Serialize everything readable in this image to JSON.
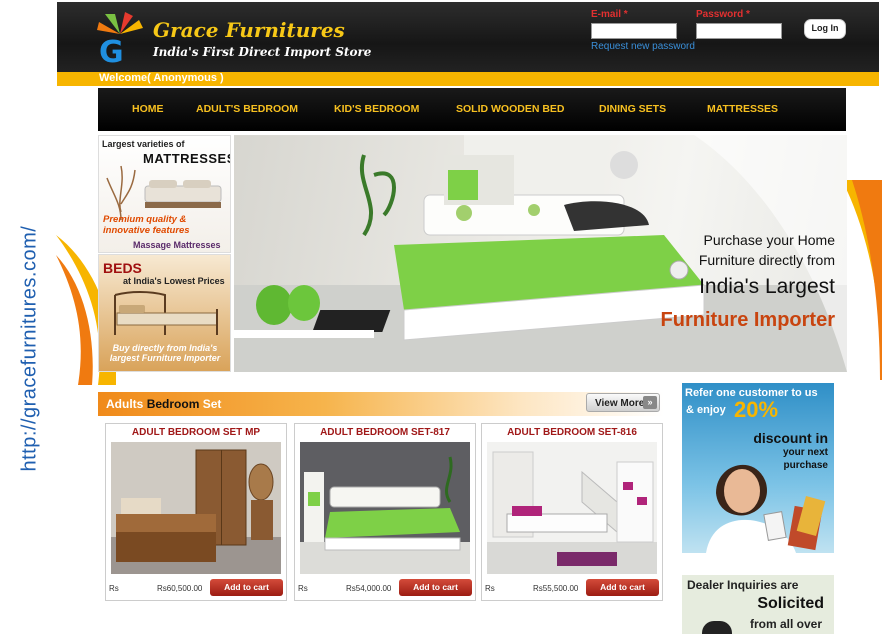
{
  "side_url": "http://gracefurnitures.com/",
  "header": {
    "brand": "Grace Furnitures",
    "tagline": "India's First Direct Import Store",
    "email_label": "E-mail *",
    "password_label": "Password *",
    "email_value": "",
    "password_value": "",
    "login_label": "Log In",
    "forgot_link": "Request new password",
    "welcome": "Welcome( Anonymous )"
  },
  "nav": {
    "items": [
      "HOME",
      "ADULT'S BEDROOM",
      "KID'S BEDROOM",
      "SOLID WOODEN BED",
      "DINING SETS",
      "MATTRESSES"
    ]
  },
  "promo_mattress": {
    "line1": "Largest varieties of",
    "heading": "MATTRESSES",
    "features": "Premium quality & innovative features",
    "caption": "Massage Mattresses"
  },
  "promo_beds": {
    "heading": "BEDS",
    "sub": "at India's Lowest Prices",
    "caption": "Buy directly from India's largest Furniture Importer"
  },
  "banner": {
    "line1": "Purchase your Home",
    "line2": "Furniture directly from",
    "line3": "India's Largest",
    "line4": "Furniture Importer"
  },
  "section": {
    "title_part1": "Adults",
    "title_part2": "Bedroom",
    "title_part3": "Set",
    "view_more": "View More",
    "view_more_icon": "double-chevron-right-icon"
  },
  "products": [
    {
      "title": "ADULT BEDROOM SET MP",
      "currency": "Rs",
      "price": "Rs60,500.00",
      "cta": "Add to cart"
    },
    {
      "title": "ADULT BEDROOM SET-817",
      "currency": "Rs",
      "price": "Rs54,000.00",
      "cta": "Add to cart"
    },
    {
      "title": "ADULT BEDROOM SET-816",
      "currency": "Rs",
      "price": "Rs55,500.00",
      "cta": "Add to cart"
    }
  ],
  "ad_referral": {
    "line1": "Refer one customer to us",
    "line2": "& enjoy",
    "percent": "20%",
    "line3": "discount in",
    "line4": "your next",
    "line5": "purchase"
  },
  "ad_dealer": {
    "line1": "Dealer Inquiries are",
    "line2": "Solicited",
    "line3": "from all over"
  },
  "colors": {
    "accent_yellow": "#f7b500",
    "nav_text": "#f7c020",
    "product_title": "#a01818",
    "link_blue": "#3a8fd9"
  }
}
